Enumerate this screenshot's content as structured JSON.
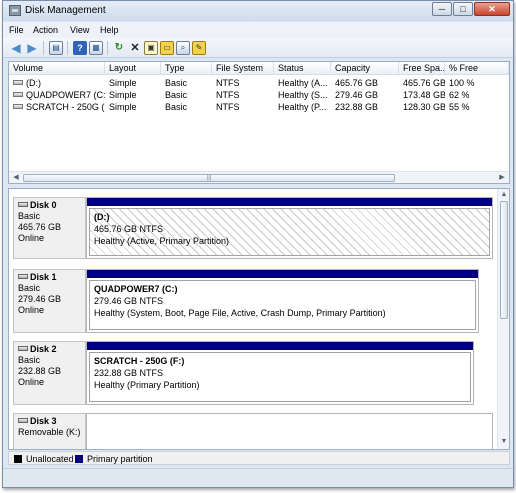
{
  "window": {
    "title": "Disk Management",
    "controls": {
      "minimize": "─",
      "maximize": "□",
      "close": "✕"
    }
  },
  "menu": [
    "File",
    "Action",
    "View",
    "Help"
  ],
  "toolbar": {
    "buttons": [
      "back-icon",
      "forward-icon",
      "console-tree-icon",
      "help-icon",
      "properties-icon",
      "refresh-icon",
      "delete-icon",
      "settings-icon",
      "open-icon",
      "search-icon",
      "export-icon"
    ]
  },
  "volume_list": {
    "columns": [
      "Volume",
      "Layout",
      "Type",
      "File System",
      "Status",
      "Capacity",
      "Free Spa...",
      "% Free"
    ],
    "rows": [
      [
        "(D:)",
        "Simple",
        "Basic",
        "NTFS",
        "Healthy (A...",
        "465.76 GB",
        "465.76 GB",
        "100 %"
      ],
      [
        "QUADPOWER7 (C:)",
        "Simple",
        "Basic",
        "NTFS",
        "Healthy (S...",
        "279.46 GB",
        "173.48 GB",
        "62 %"
      ],
      [
        "SCRATCH - 250G (...",
        "Simple",
        "Basic",
        "NTFS",
        "Healthy (P...",
        "232.88 GB",
        "128.30 GB",
        "55 %"
      ]
    ]
  },
  "disks": [
    {
      "name": "Disk 0",
      "type": "Basic",
      "size": "465.76 GB",
      "status": "Online",
      "partition": {
        "name": "(D:)",
        "size_fs": "465.76 GB NTFS",
        "status": "Healthy (Active, Primary Partition)"
      }
    },
    {
      "name": "Disk 1",
      "type": "Basic",
      "size": "279.46 GB",
      "status": "Online",
      "partition": {
        "name": "QUADPOWER7  (C:)",
        "size_fs": "279.46 GB NTFS",
        "status": "Healthy (System, Boot, Page File, Active, Crash Dump, Primary Partition)"
      }
    },
    {
      "name": "Disk 2",
      "type": "Basic",
      "size": "232.88 GB",
      "status": "Online",
      "partition": {
        "name": "SCRATCH - 250G  (F:)",
        "size_fs": "232.88 GB NTFS",
        "status": "Healthy (Primary Partition)"
      }
    },
    {
      "name": "Disk 3",
      "type": "Removable (K:)"
    }
  ],
  "legend": [
    {
      "label": "Unallocated",
      "color": "#000000"
    },
    {
      "label": "Primary partition",
      "color": "#00007e"
    }
  ],
  "colors": {
    "partition_bar": "#00007e",
    "unallocated": "#000000"
  }
}
